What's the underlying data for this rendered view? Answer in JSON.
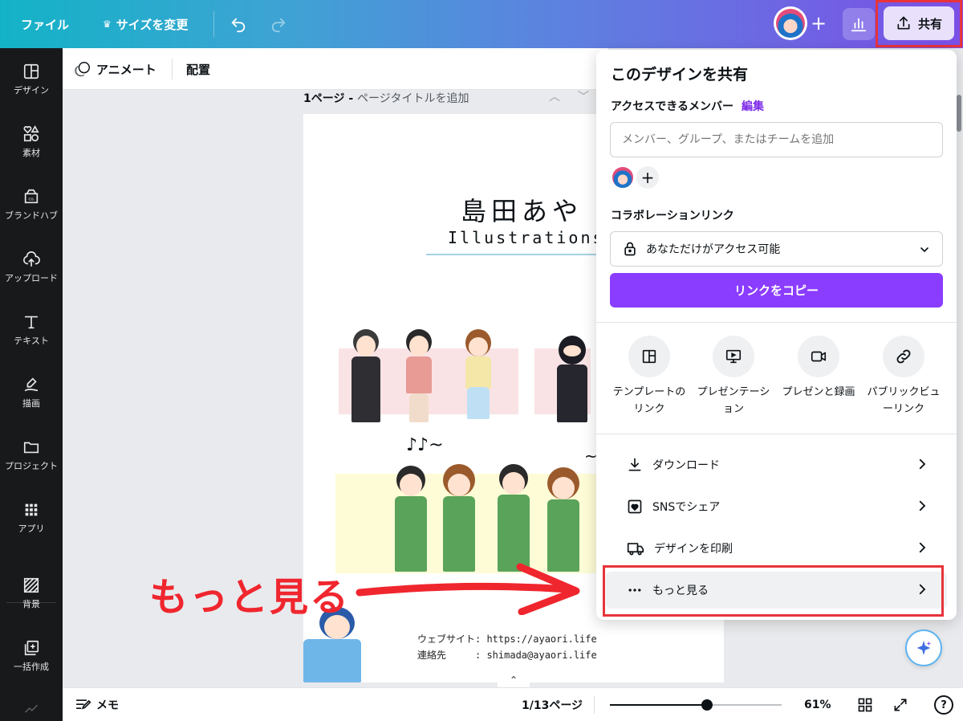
{
  "topbar": {
    "file_label": "ファイル",
    "resize_label": "サイズを変更",
    "share_label": "共有"
  },
  "sidebar": {
    "items": [
      {
        "label": "デザイン",
        "icon": "layout-icon"
      },
      {
        "label": "素材",
        "icon": "elements-icon"
      },
      {
        "label": "ブランドハブ",
        "icon": "brand-icon"
      },
      {
        "label": "アップロード",
        "icon": "upload-icon"
      },
      {
        "label": "テキスト",
        "icon": "text-icon"
      },
      {
        "label": "描画",
        "icon": "draw-icon"
      },
      {
        "label": "プロジェクト",
        "icon": "folder-icon"
      },
      {
        "label": "アプリ",
        "icon": "apps-icon"
      },
      {
        "label": "背景",
        "icon": "background-icon"
      },
      {
        "label": "一括作成",
        "icon": "bulk-create-icon"
      }
    ]
  },
  "context_toolbar": {
    "animate_label": "アニメート",
    "arrange_label": "配置"
  },
  "page_header": {
    "page_number": "1ページ",
    "separator": " - ",
    "title_placeholder": "ページタイトルを追加"
  },
  "canvas": {
    "name": "島田あや",
    "subtitle": "Illustrations",
    "notes": "♪♪~",
    "tilde": "~",
    "website_row": "ウェブサイト: https://ayaori.life",
    "contact_row": "連絡先　　　: shimada@ayaori.life"
  },
  "annotation": {
    "text": "もっと見る"
  },
  "share_panel": {
    "title": "このデザインを共有",
    "access_label": "アクセスできるメンバー",
    "edit_label": "編集",
    "member_input_placeholder": "メンバー、グループ、またはチームを追加",
    "collab_link_label": "コラボレーションリンク",
    "access_option": "あなただけがアクセス可能",
    "copy_link_label": "リンクをコピー",
    "options": [
      {
        "label": "テンプレートのリンク",
        "icon": "template-icon"
      },
      {
        "label": "プレゼンテーション",
        "icon": "present-icon"
      },
      {
        "label": "プレゼンと録画",
        "icon": "record-icon"
      },
      {
        "label": "パブリックビューリンク",
        "icon": "link-icon"
      }
    ],
    "rows": [
      {
        "label": "ダウンロード",
        "icon": "download-icon"
      },
      {
        "label": "SNSでシェア",
        "icon": "heart-icon"
      },
      {
        "label": "デザインを印刷",
        "icon": "truck-icon"
      },
      {
        "label": "もっと見る",
        "icon": "more-icon"
      }
    ]
  },
  "bottombar": {
    "memo_label": "メモ",
    "page_indicator": "1/13ページ",
    "zoom_label": "61%",
    "zoom_value": 61,
    "help_label": "?"
  },
  "colors": {
    "accent": "#8b3dff",
    "highlight": "#e8333b",
    "sidebar_bg": "#18191b"
  }
}
